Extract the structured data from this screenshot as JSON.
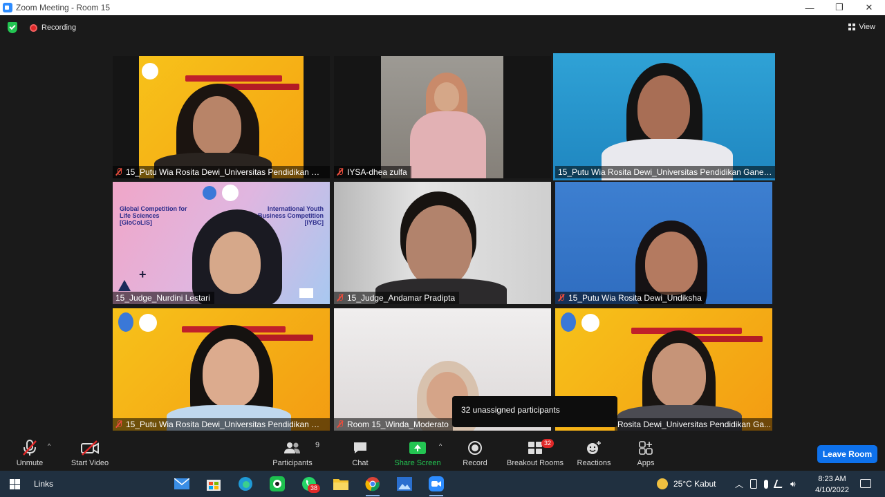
{
  "window": {
    "title": "Zoom Meeting - Room 15",
    "minimize": "—",
    "restore": "❐",
    "close": "✕"
  },
  "topbar": {
    "recording_label": "Recording",
    "view_label": "View"
  },
  "tiles": [
    {
      "name": "15_Putu Wia Rosita Dewi_Universitas Pendidikan Ga...",
      "muted": true
    },
    {
      "name": "IYSA-dhea zulfa",
      "muted": true
    },
    {
      "name": "15_Putu Wia Rosita Dewi_Universitas Pendidikan Ganes...",
      "muted": false
    },
    {
      "name": "15_Judge_Nurdini Lestari",
      "muted": false
    },
    {
      "name": "15_Judge_Andamar Pradipta",
      "muted": true
    },
    {
      "name": "15_Putu Wia Rosita Dewi_Undiksha",
      "muted": true
    },
    {
      "name": "15_Putu Wia Rosita Dewi_Universitas Pendidikan Ga...",
      "muted": true
    },
    {
      "name": "Room 15_Winda_Moderato",
      "muted": true
    },
    {
      "name": "Rosita Dewi_Universitas Pendidikan Ga...",
      "muted": false
    }
  ],
  "banners": {
    "glocolis_left": "Global Competition for Life Sciences [GloCoLiS]",
    "iybc_right": "International Youth Business Competition [IYBC]",
    "glocolis_logo": "GloCoLiS"
  },
  "tooltip": {
    "text": "32 unassigned participants"
  },
  "toolbar": {
    "unmute": "Unmute",
    "start_video": "Start Video",
    "participants": "Participants",
    "participants_count": "9",
    "chat": "Chat",
    "share_screen": "Share Screen",
    "record": "Record",
    "breakout_rooms": "Breakout Rooms",
    "breakout_badge": "32",
    "reactions": "Reactions",
    "apps": "Apps",
    "leave_room": "Leave Room",
    "caret": "^"
  },
  "taskbar": {
    "links_label": "Links",
    "whatsapp_badge": "38",
    "weather": "25°C  Kabut",
    "time": "8:23 AM",
    "date": "4/10/2022"
  },
  "colors": {
    "accent": "#0e71eb",
    "share_green": "#23c552",
    "record_red": "#e02828",
    "active_speaker": "#e8e070"
  }
}
